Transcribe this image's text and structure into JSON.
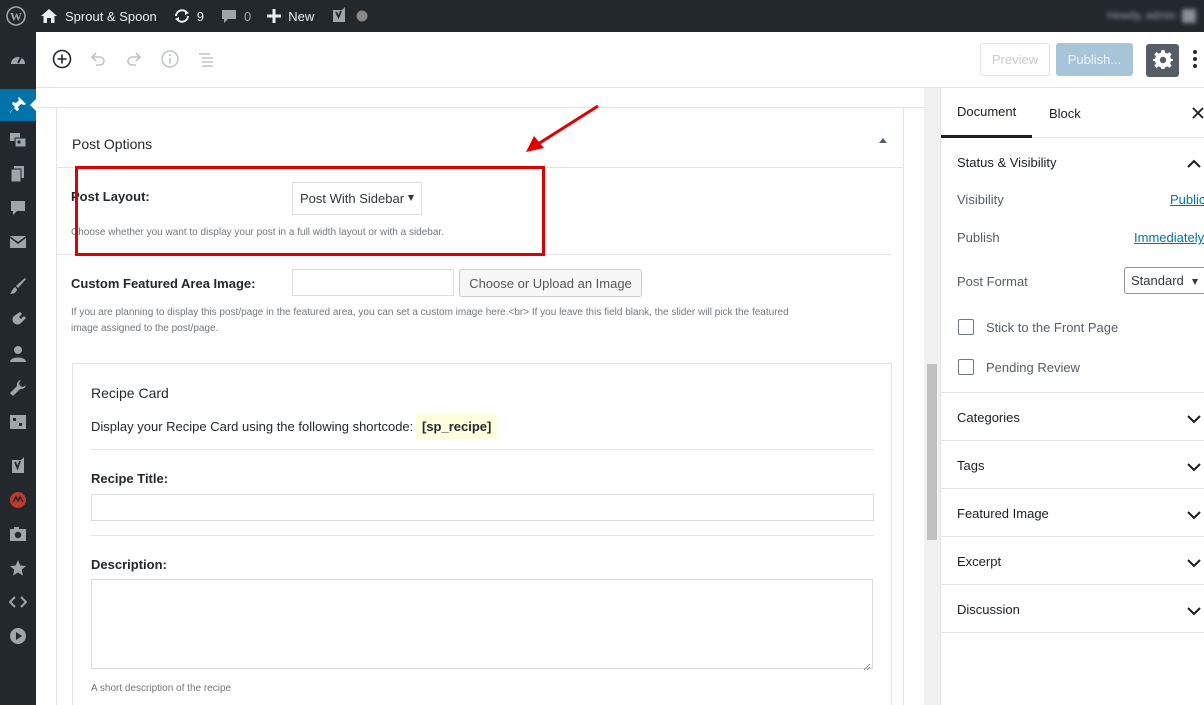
{
  "admin_bar": {
    "site_name": "Sprout & Spoon",
    "updates_count": "9",
    "comments_count": "0",
    "new_label": "New",
    "howdy_text": "Howdy, admin"
  },
  "editor": {
    "preview_label": "Preview",
    "publish_label": "Publish..."
  },
  "post_options": {
    "title": "Post Options",
    "layout_label": "Post Layout:",
    "layout_value": "Post With Sidebar",
    "layout_help": "Choose whether you want to display your post in a full width layout or with a sidebar.",
    "featured_label": "Custom Featured Area Image:",
    "featured_button": "Choose or Upload an Image",
    "featured_help_1": "If you are planning to display this post/page in the featured area, you can set a custom image here.<br> If you leave this field blank, the slider will pick the featured",
    "featured_help_2": "image assigned to the post/page."
  },
  "recipe_card": {
    "title": "Recipe Card",
    "shortcode_text": "Display your Recipe Card using the following shortcode:",
    "shortcode": "[sp_recipe]",
    "recipe_title_label": "Recipe Title:",
    "description_label": "Description:",
    "description_help": "A short description of the recipe"
  },
  "sidebar": {
    "tabs": [
      "Document",
      "Block"
    ],
    "status_title": "Status & Visibility",
    "visibility_label": "Visibility",
    "visibility_value": "Public",
    "publish_label": "Publish",
    "publish_value": "Immediately",
    "format_label": "Post Format",
    "format_value": "Standard",
    "sticky_label": "Stick to the Front Page",
    "pending_label": "Pending Review",
    "panels": [
      "Categories",
      "Tags",
      "Featured Image",
      "Excerpt",
      "Discussion"
    ]
  },
  "colors": {
    "admin_bar_bg": "#23282d",
    "accent": "#0073aa",
    "highlight_red": "#e00000"
  }
}
